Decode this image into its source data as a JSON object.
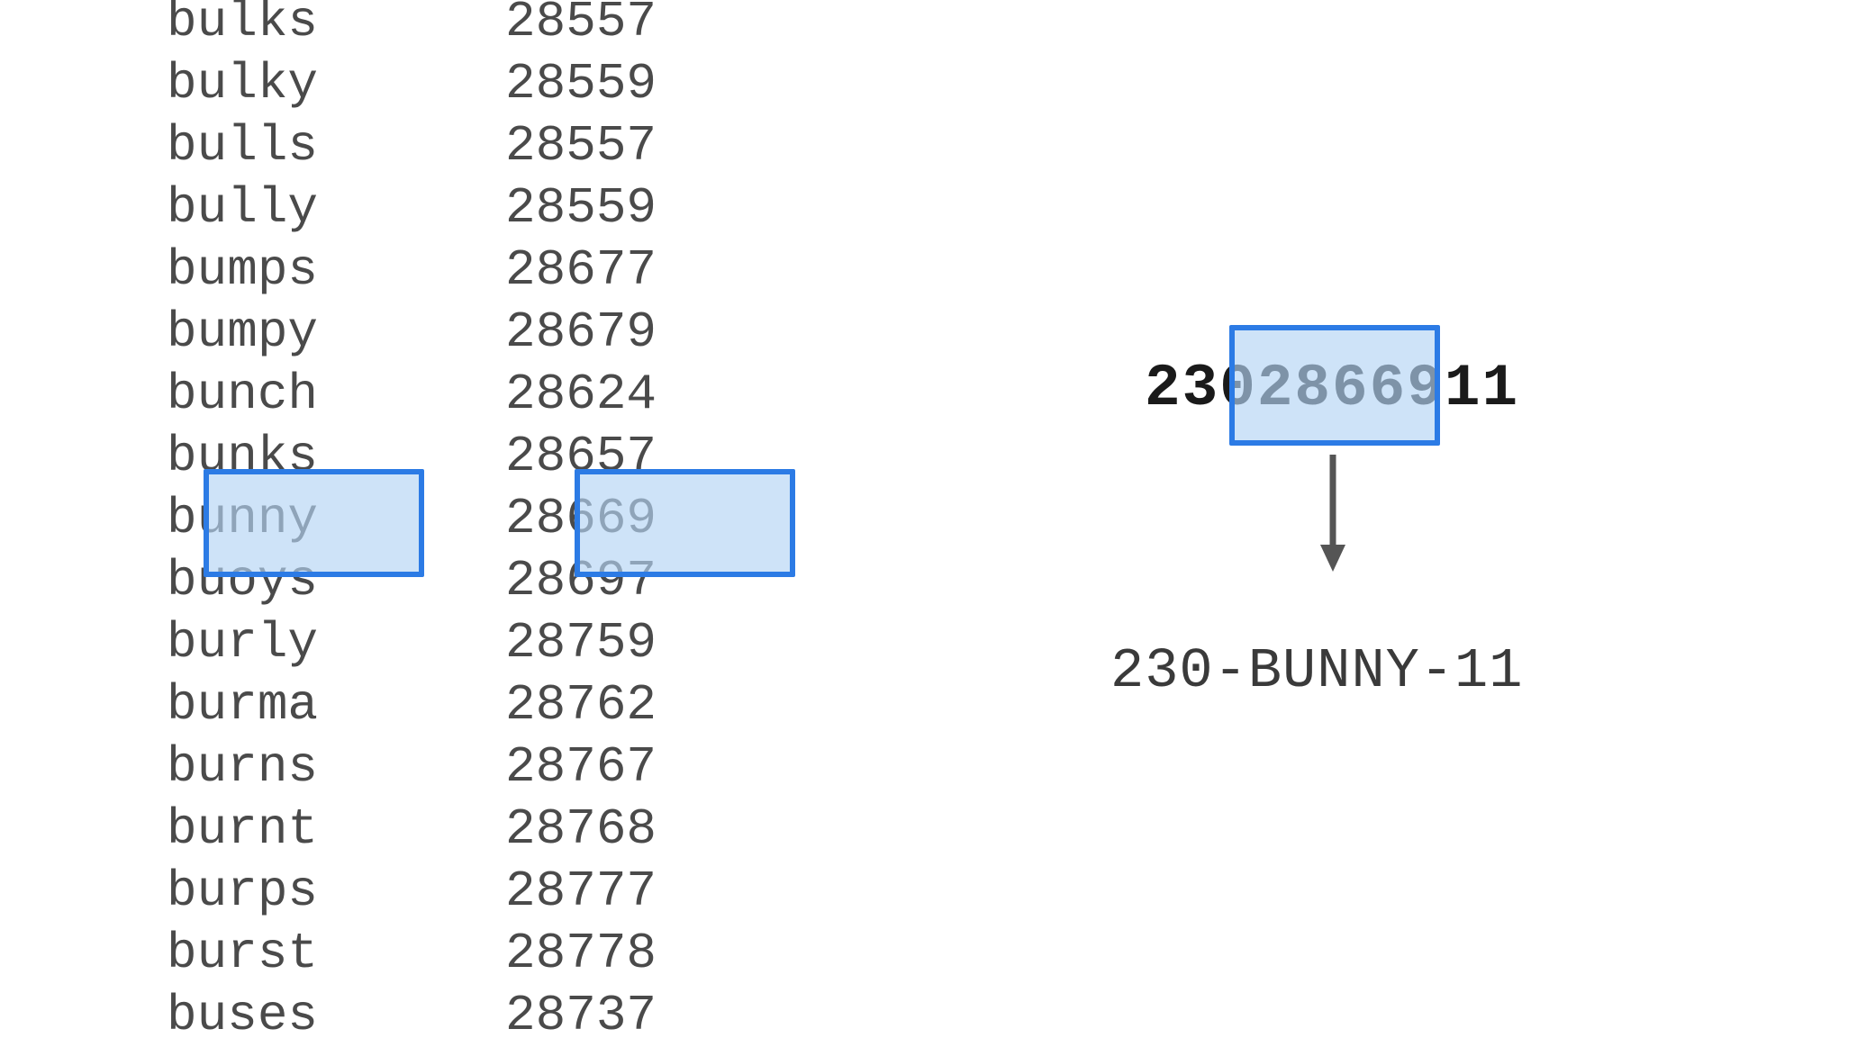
{
  "words": [
    {
      "word": "bulks",
      "num": "28557"
    },
    {
      "word": "bulky",
      "num": "28559"
    },
    {
      "word": "bulls",
      "num": "28557"
    },
    {
      "word": "bully",
      "num": "28559"
    },
    {
      "word": "bumps",
      "num": "28677"
    },
    {
      "word": "bumpy",
      "num": "28679"
    },
    {
      "word": "bunch",
      "num": "28624"
    },
    {
      "word": "bunks",
      "num": "28657"
    },
    {
      "word": "bunny",
      "num": "28669"
    },
    {
      "word": "buoys",
      "num": "28697"
    },
    {
      "word": "burly",
      "num": "28759"
    },
    {
      "word": "burma",
      "num": "28762"
    },
    {
      "word": "burns",
      "num": "28767"
    },
    {
      "word": "burnt",
      "num": "28768"
    },
    {
      "word": "burps",
      "num": "28777"
    },
    {
      "word": "burst",
      "num": "28778"
    },
    {
      "word": "buses",
      "num": "28737"
    }
  ],
  "highlighted_index": 8,
  "input_number": "2302866911",
  "result": "230-BUNNY-11",
  "colors": {
    "highlight_fill": "#b3d4f5",
    "highlight_border": "#2c7be5"
  }
}
